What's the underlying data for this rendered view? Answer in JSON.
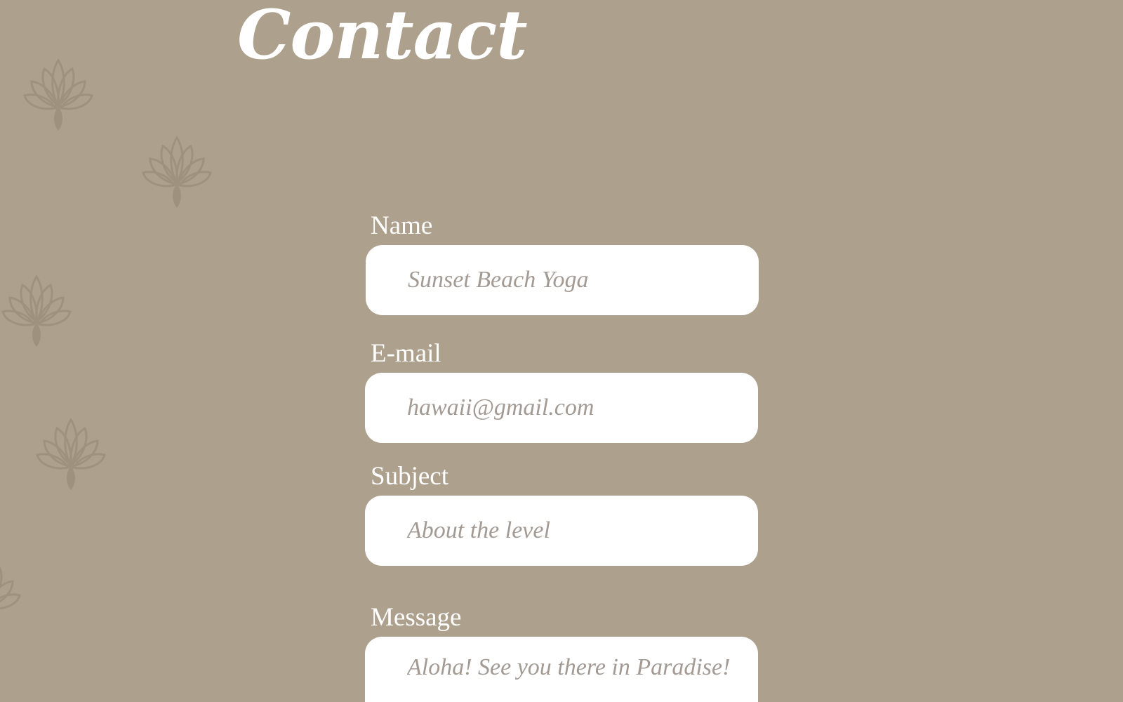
{
  "page": {
    "heading": "Contact",
    "background_color": "#ada08d",
    "decoration_icon": "lotus-flower-icon"
  },
  "form": {
    "name": {
      "label": "Name",
      "placeholder": "Sunset Beach Yoga"
    },
    "email": {
      "label": "E-mail",
      "placeholder": "hawaii@gmail.com"
    },
    "subject": {
      "label": "Subject",
      "placeholder": "About the level"
    },
    "message": {
      "label": "Message",
      "placeholder": "Aloha! See you there in Paradise!"
    }
  }
}
